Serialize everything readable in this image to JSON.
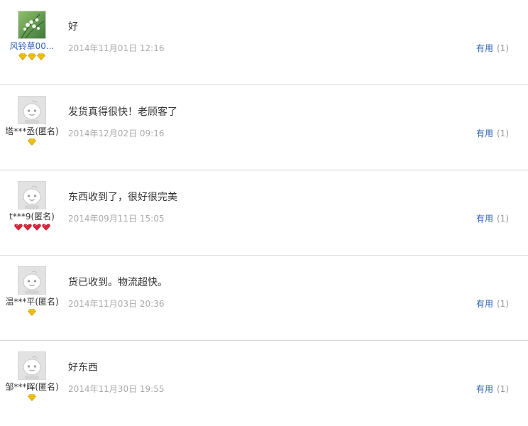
{
  "colors": {
    "link": "#2f64b5",
    "date": "#aaaaaa",
    "divider": "#d9d9d9",
    "badge_gold": "#f5c518",
    "badge_red": "#d9253a"
  },
  "reviews": [
    {
      "user": "风铃草00...",
      "avatar": "flower-photo",
      "badge_type": "gold-diamond",
      "badge_count": 3,
      "content": "好",
      "date": "2014年11月01日 12:16",
      "useful_label": "有用",
      "useful_count": "(1)"
    },
    {
      "user": "塔***丞(匿名)",
      "avatar": "default-face",
      "badge_type": "gold-diamond",
      "badge_count": 1,
      "content": "发货真得很快！老顾客了",
      "date": "2014年12月02日 09:16",
      "useful_label": "有用",
      "useful_count": "(1)"
    },
    {
      "user": "t***9(匿名)",
      "avatar": "default-face",
      "badge_type": "red-heart",
      "badge_count": 4,
      "content": "东西收到了，很好很完美",
      "date": "2014年09月11日 15:05",
      "useful_label": "有用",
      "useful_count": "(1)"
    },
    {
      "user": "温***平(匿名)",
      "avatar": "default-face",
      "badge_type": "gold-diamond",
      "badge_count": 1,
      "content": "货已收到。物流超快。",
      "date": "2014年11月03日 20:36",
      "useful_label": "有用",
      "useful_count": "(1)"
    },
    {
      "user": "邹***晖(匿名)",
      "avatar": "default-face",
      "badge_type": "gold-diamond",
      "badge_count": 1,
      "content": "好东西",
      "date": "2014年11月30日 19:55",
      "useful_label": "有用",
      "useful_count": "(1)"
    }
  ]
}
